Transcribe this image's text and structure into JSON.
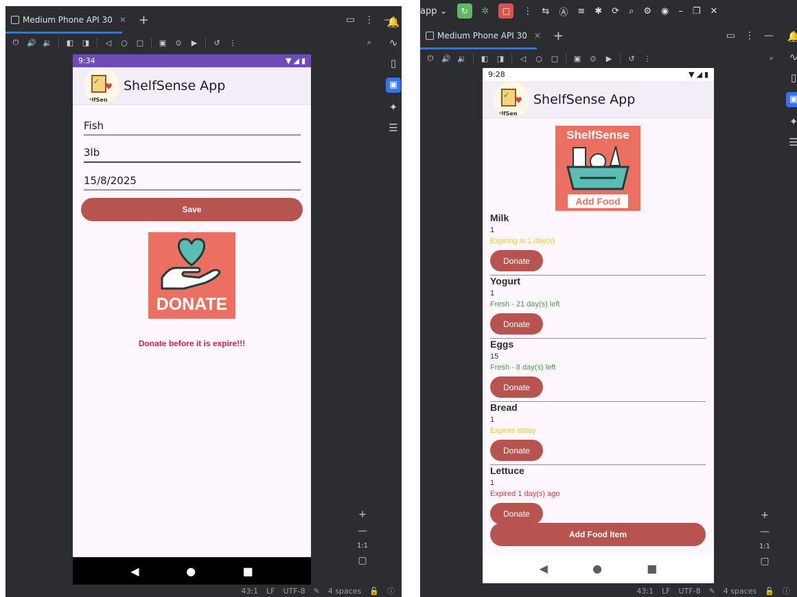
{
  "left_window": {
    "tab_label": "Medium Phone API 30",
    "status": [
      "43:1",
      "LF",
      "UTF-8",
      "4 spaces"
    ],
    "zoom_ratio": "1:1",
    "phone": {
      "time": "9:34",
      "app_title": "ShelfSense App",
      "logo_text": "elfSen",
      "fields": [
        {
          "name": "food-name-field",
          "value": "Fish"
        },
        {
          "name": "quantity-field",
          "value": "3lb"
        },
        {
          "name": "expiry-date-field",
          "value": "15/8/2025"
        }
      ],
      "save_label": "Save",
      "donate_tile_text": "DONATE",
      "warning": "Donate before it is expire!!!"
    }
  },
  "right_window": {
    "run_config": "app",
    "tab_label": "Medium Phone API 30",
    "status": [
      "43:1",
      "LF",
      "UTF-8",
      "4 spaces"
    ],
    "zoom_ratio": "1:1",
    "phone": {
      "time": "9:28",
      "app_title": "ShelfSense App",
      "logo_text": "elfSen",
      "add_food_tile": {
        "title": "ShelfSense",
        "label": "Add Food"
      },
      "items": [
        {
          "name": "Milk",
          "qty": "1",
          "status": "Expiring in 1 day(s)",
          "status_color": "#f9c623",
          "button": "Donate"
        },
        {
          "name": "Yogurt",
          "qty": "1",
          "status": "Fresh - 21 day(s) left",
          "status_color": "#43a047",
          "button": "Donate"
        },
        {
          "name": "Eggs",
          "qty": "15",
          "status": "Fresh - 8 day(s) left",
          "status_color": "#43a047",
          "button": "Donate"
        },
        {
          "name": "Bread",
          "qty": "1",
          "status": "Expires today",
          "status_color": "#f9c623",
          "button": "Donate"
        },
        {
          "name": "Lettuce",
          "qty": "1",
          "status": "Expired 1 day(s) ago",
          "status_color": "#e53935",
          "button": "Donate"
        }
      ],
      "add_item_label": "Add Food Item"
    }
  },
  "colors": {
    "ide_bg": "#2b2d30",
    "accent": "#3574f0",
    "button": "#b85450",
    "tile": "#ec7061",
    "status_bar_purple": "#6f4bb8"
  }
}
